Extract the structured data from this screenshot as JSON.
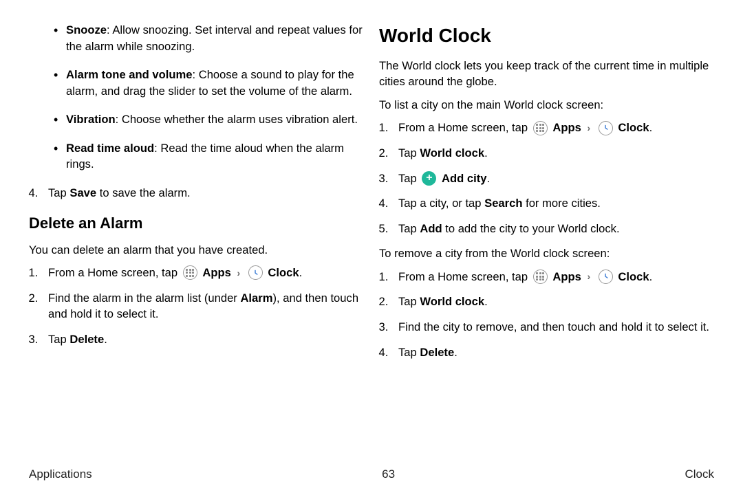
{
  "left": {
    "bullets": [
      {
        "term": "Snooze",
        "rest": ": Allow snoozing. Set interval and repeat values for the alarm while snoozing."
      },
      {
        "term": "Alarm tone and volume",
        "rest": ": Choose a sound to play for the alarm, and drag the slider to set the volume of the alarm."
      },
      {
        "term": "Vibration",
        "rest": ": Choose whether the alarm uses vibration alert."
      },
      {
        "term": "Read time aloud",
        "rest": ": Read the time aloud when the alarm rings."
      }
    ],
    "step4_pre": "Tap ",
    "step4_bold": "Save",
    "step4_post": " to save the alarm.",
    "delete_heading": "Delete an Alarm",
    "delete_intro": "You can delete an alarm that you have created.",
    "del_step1_pre": "From a Home screen, tap ",
    "apps_label": "Apps",
    "clock_label": "Clock",
    "del_step2_a": "Find the alarm in the alarm list (under ",
    "del_step2_b": "Alarm",
    "del_step2_c": "), and then touch and hold it to select it.",
    "del_step3_pre": "Tap ",
    "del_step3_bold": "Delete",
    "del_step3_post": "."
  },
  "right": {
    "heading": "World Clock",
    "intro": "The World clock lets you keep track of the current time in multiple cities around the globe.",
    "list_intro": "To list a city on the main World clock screen:",
    "apps_label": "Apps",
    "clock_label": "Clock",
    "r_step1_pre": "From a Home screen, tap ",
    "r_step2_pre": "Tap ",
    "r_step2_bold": "World clock",
    "r_step2_post": ".",
    "r_step3_pre": "Tap ",
    "r_step3_bold": "Add city",
    "r_step3_post": ".",
    "r_step4_a": "Tap a city, or tap ",
    "r_step4_b": "Search",
    "r_step4_c": " for more cities.",
    "r_step5_a": "Tap ",
    "r_step5_b": "Add",
    "r_step5_c": " to add the city to your World clock.",
    "remove_intro": "To remove a city from the World clock screen:",
    "rm_step1_pre": "From a Home screen, tap ",
    "rm_step2_pre": "Tap ",
    "rm_step2_bold": "World clock",
    "rm_step2_post": ".",
    "rm_step3": "Find the city to remove, and then touch and hold it to select it.",
    "rm_step4_pre": "Tap ",
    "rm_step4_bold": "Delete",
    "rm_step4_post": "."
  },
  "footer": {
    "left": "Applications",
    "center": "63",
    "right": "Clock"
  }
}
